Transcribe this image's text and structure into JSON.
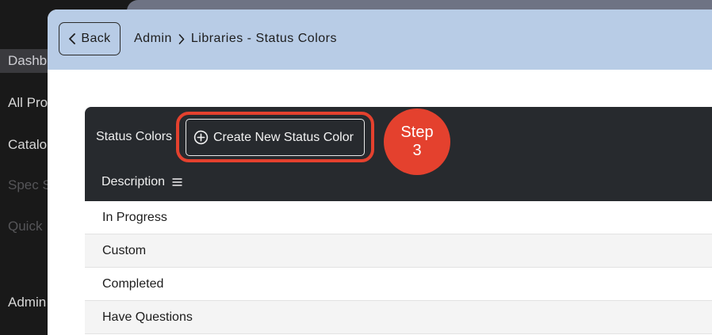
{
  "sidebar": {
    "items": [
      {
        "label": "Dashb",
        "active": true
      },
      {
        "label": "All Pro"
      },
      {
        "label": "Catalo"
      },
      {
        "label": "Spec S",
        "dim": true
      },
      {
        "label": "Quick",
        "dim": true
      },
      {
        "label": "Admin"
      }
    ]
  },
  "header": {
    "back_label": "Back",
    "breadcrumb_root": "Admin",
    "breadcrumb_current": "Libraries - Status Colors"
  },
  "panel": {
    "title": "Status Colors",
    "create_label": "Create New Status Color",
    "column_header": "Description",
    "rows": [
      "In Progress",
      "Custom",
      "Completed",
      "Have Questions"
    ]
  },
  "annotation": {
    "step_word": "Step",
    "step_number": "3",
    "color": "#e4412e"
  },
  "colors": {
    "header_bg": "#b8cce6",
    "toolbar_bg": "#272a2e"
  }
}
